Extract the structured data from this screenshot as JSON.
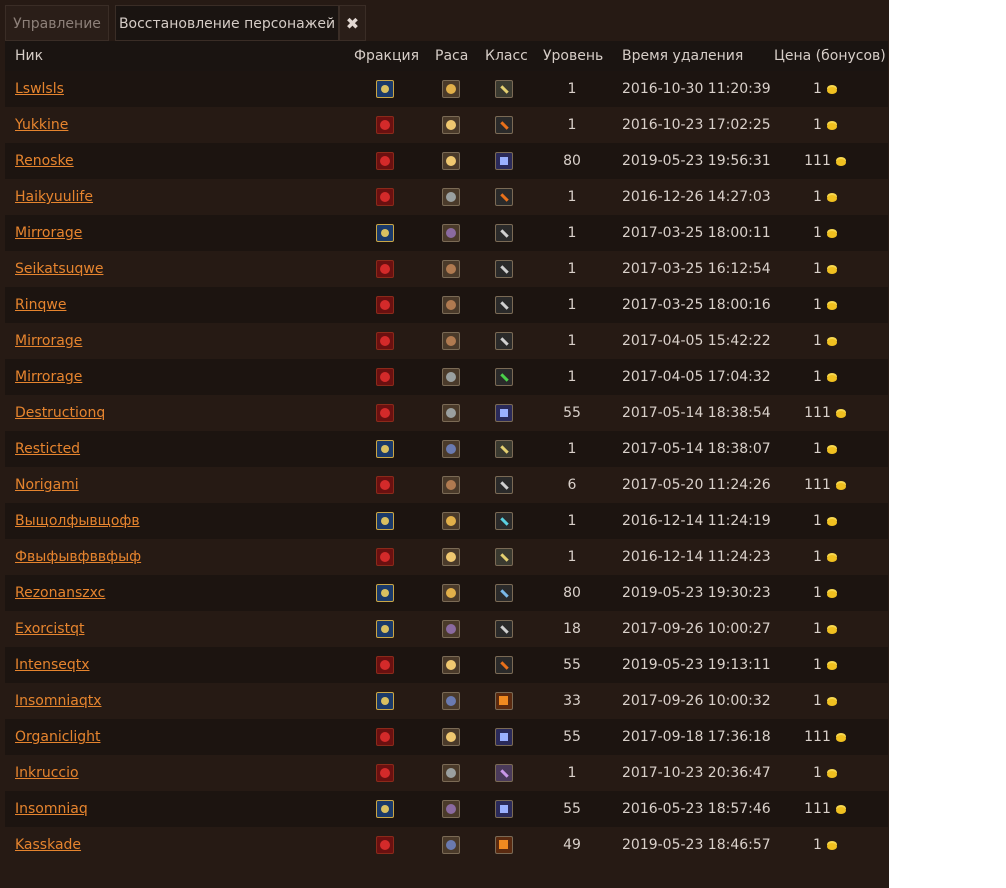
{
  "tabs": {
    "manage": "Управление",
    "restore": "Восстановление персонажей",
    "close": "✖"
  },
  "columns": {
    "nick": "Ник",
    "faction": "Фракция",
    "race": "Раса",
    "class": "Класс",
    "level": "Уровень",
    "deleted": "Время удаления",
    "price": "Цена (бонусов)"
  },
  "rows": [
    {
      "nick": "Lswlsls",
      "faction": "alliance",
      "race": "r1",
      "class": "k1",
      "level": "1",
      "deleted": "2016-10-30 11:20:39",
      "price": "1"
    },
    {
      "nick": "Yukkine",
      "faction": "horde",
      "race": "r2",
      "class": "k2",
      "level": "1",
      "deleted": "2016-10-23 17:02:25",
      "price": "1"
    },
    {
      "nick": "Renoske",
      "faction": "horde",
      "race": "r2",
      "class": "k3",
      "level": "80",
      "deleted": "2019-05-23 19:56:31",
      "price": "111"
    },
    {
      "nick": "Haikyuulife",
      "faction": "horde",
      "race": "r3",
      "class": "k2",
      "level": "1",
      "deleted": "2016-12-26 14:27:03",
      "price": "1"
    },
    {
      "nick": "Mirrorage",
      "faction": "alliance",
      "race": "r6",
      "class": "k4",
      "level": "1",
      "deleted": "2017-03-25 18:00:11",
      "price": "1"
    },
    {
      "nick": "Seikatsuqwe",
      "faction": "horde",
      "race": "r4",
      "class": "k4",
      "level": "1",
      "deleted": "2017-03-25 16:12:54",
      "price": "1"
    },
    {
      "nick": "Rinqwe",
      "faction": "horde",
      "race": "r4",
      "class": "k4",
      "level": "1",
      "deleted": "2017-03-25 18:00:16",
      "price": "1"
    },
    {
      "nick": "Mirrorage",
      "faction": "horde",
      "race": "r4",
      "class": "k4",
      "level": "1",
      "deleted": "2017-04-05 15:42:22",
      "price": "1"
    },
    {
      "nick": "Mirrorage",
      "faction": "horde",
      "race": "r3",
      "class": "k5",
      "level": "1",
      "deleted": "2017-04-05 17:04:32",
      "price": "1"
    },
    {
      "nick": "Destructionq",
      "faction": "horde",
      "race": "r3",
      "class": "k3",
      "level": "55",
      "deleted": "2017-05-14 18:38:54",
      "price": "111"
    },
    {
      "nick": "Resticted",
      "faction": "alliance",
      "race": "r5",
      "class": "k1",
      "level": "1",
      "deleted": "2017-05-14 18:38:07",
      "price": "1"
    },
    {
      "nick": "Norigami",
      "faction": "horde",
      "race": "r4",
      "class": "k4",
      "level": "6",
      "deleted": "2017-05-20 11:24:26",
      "price": "111"
    },
    {
      "nick": "Выщолфывщофв",
      "faction": "alliance",
      "race": "r1",
      "class": "k6",
      "level": "1",
      "deleted": "2016-12-14 11:24:19",
      "price": "1"
    },
    {
      "nick": "Фвыфывфввфыф",
      "faction": "horde",
      "race": "r2",
      "class": "k1",
      "level": "1",
      "deleted": "2016-12-14 11:24:23",
      "price": "1"
    },
    {
      "nick": "Rezonanszxc",
      "faction": "alliance",
      "race": "r1",
      "class": "k7",
      "level": "80",
      "deleted": "2019-05-23 19:30:23",
      "price": "1"
    },
    {
      "nick": "Exorcistqt",
      "faction": "alliance",
      "race": "r6",
      "class": "k4",
      "level": "18",
      "deleted": "2017-09-26 10:00:27",
      "price": "1"
    },
    {
      "nick": "Intenseqtx",
      "faction": "horde",
      "race": "r2",
      "class": "k2",
      "level": "55",
      "deleted": "2019-05-23 19:13:11",
      "price": "1"
    },
    {
      "nick": "Insomniaqtx",
      "faction": "alliance",
      "race": "r5",
      "class": "k8",
      "level": "33",
      "deleted": "2017-09-26 10:00:32",
      "price": "1"
    },
    {
      "nick": "Organiclight",
      "faction": "horde",
      "race": "r2",
      "class": "k3",
      "level": "55",
      "deleted": "2017-09-18 17:36:18",
      "price": "111"
    },
    {
      "nick": "Inkruccio",
      "faction": "horde",
      "race": "r3",
      "class": "k9",
      "level": "1",
      "deleted": "2017-10-23 20:36:47",
      "price": "1"
    },
    {
      "nick": "Insomniaq",
      "faction": "alliance",
      "race": "r6",
      "class": "k3",
      "level": "55",
      "deleted": "2016-05-23 18:57:46",
      "price": "111"
    },
    {
      "nick": "Kasskade",
      "faction": "horde",
      "race": "r5",
      "class": "k8",
      "level": "49",
      "deleted": "2019-05-23 18:46:57",
      "price": "1"
    }
  ]
}
